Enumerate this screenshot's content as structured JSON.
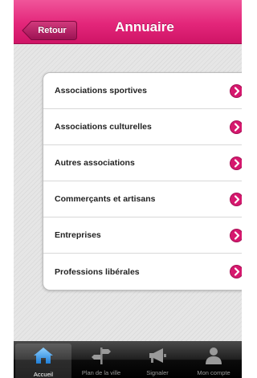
{
  "header": {
    "back_label": "Retour",
    "title": "Annuaire"
  },
  "directory": {
    "items": [
      {
        "label": "Associations sportives"
      },
      {
        "label": "Associations culturelles"
      },
      {
        "label": "Autres associations"
      },
      {
        "label": "Commerçants et artisans"
      },
      {
        "label": "Entreprises"
      },
      {
        "label": "Professions libérales"
      }
    ]
  },
  "tab_bar": {
    "tabs": [
      {
        "label": "Accueil",
        "icon": "home-icon",
        "active": true
      },
      {
        "label": "Plan de la ville",
        "icon": "signpost-icon",
        "active": false
      },
      {
        "label": "Signaler",
        "icon": "megaphone-icon",
        "active": false
      },
      {
        "label": "Mon compte",
        "icon": "user-icon",
        "active": false
      }
    ]
  },
  "colors": {
    "accent": "#e3267a",
    "header_dark": "#cf1466",
    "tab_bar": "#111111"
  }
}
